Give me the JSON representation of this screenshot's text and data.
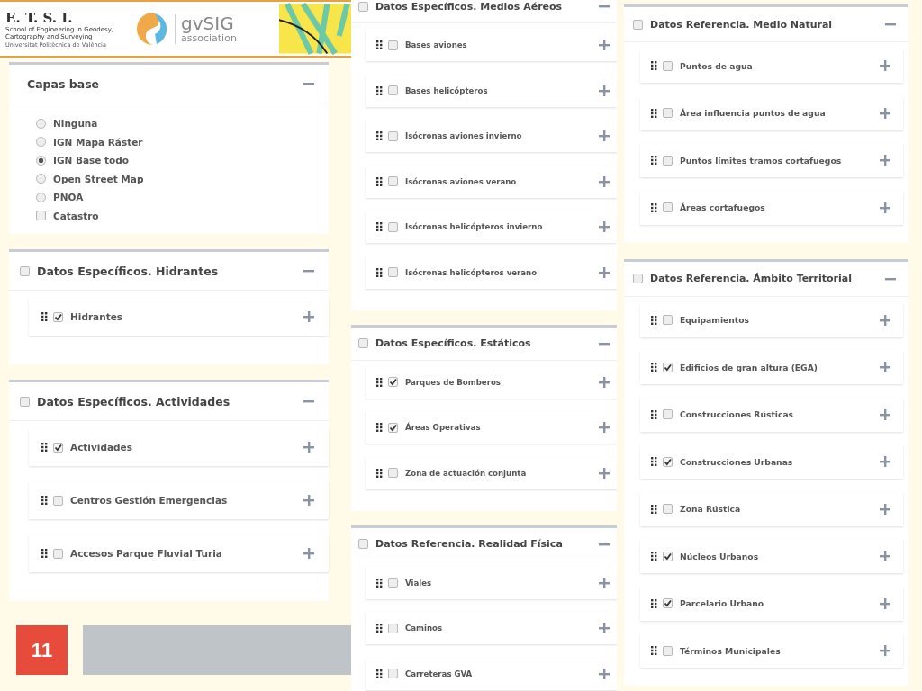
{
  "banner": {
    "etsi_title": "E. T. S. I.",
    "etsi_subtitle": "School of Engineering in Geodesy, Cartography and Surveying",
    "etsi_university": "Universitat Politècnica de València",
    "gvsig_name": "gvSIG",
    "gvsig_subtitle": "association"
  },
  "columns": [
    [
      {
        "kind": "base_layers",
        "title": "Capas base",
        "expanded": true,
        "options": [
          {
            "kind": "radio",
            "label": "Ninguna",
            "selected": false
          },
          {
            "kind": "radio",
            "label": "IGN Mapa Ráster",
            "selected": false
          },
          {
            "kind": "radio",
            "label": "IGN Base todo",
            "selected": true
          },
          {
            "kind": "radio",
            "label": "Open Street Map",
            "selected": false
          },
          {
            "kind": "radio",
            "label": "PNOA",
            "selected": false
          },
          {
            "kind": "checkbox",
            "label": "Catastro",
            "checked": false
          }
        ]
      },
      {
        "kind": "layer_group",
        "title": "Datos Específicos. Hidrantes",
        "checked": false,
        "expanded": true,
        "layers": [
          {
            "label": "Hidrantes",
            "checked": true
          }
        ]
      },
      {
        "kind": "layer_group",
        "title": "Datos Específicos. Actividades",
        "checked": false,
        "expanded": true,
        "layers": [
          {
            "label": "Actividades",
            "checked": true
          },
          {
            "label": "Centros Gestión Emergencias",
            "checked": false
          },
          {
            "label": "Accesos Parque Fluvial Turia",
            "checked": false
          }
        ]
      }
    ],
    [
      {
        "kind": "layer_group",
        "title": "Datos Específicos. Medios Aéreos",
        "checked": false,
        "expanded": true,
        "layers": [
          {
            "label": "Bases aviones",
            "checked": false
          },
          {
            "label": "Bases helicópteros",
            "checked": false
          },
          {
            "label": "Isócronas aviones invierno",
            "checked": false
          },
          {
            "label": "Isócronas aviones verano",
            "checked": false
          },
          {
            "label": "Isócronas helicópteros invierno",
            "checked": false
          },
          {
            "label": "Isócronas helicópteros verano",
            "checked": false
          }
        ]
      },
      {
        "kind": "layer_group",
        "title": "Datos Específicos. Estáticos",
        "checked": false,
        "expanded": true,
        "layers": [
          {
            "label": "Parques de Bomberos",
            "checked": true
          },
          {
            "label": "Áreas Operativas",
            "checked": true
          },
          {
            "label": "Zona de actuación conjunta",
            "checked": false
          }
        ]
      },
      {
        "kind": "layer_group",
        "title": "Datos Referencia. Realidad Física",
        "checked": false,
        "expanded": true,
        "layers": [
          {
            "label": "Viales",
            "checked": false
          },
          {
            "label": "Caminos",
            "checked": false
          },
          {
            "label": "Carreteras GVA",
            "checked": false
          }
        ]
      }
    ],
    [
      {
        "kind": "layer_group",
        "title": "Datos Referencia. Medio Natural",
        "checked": false,
        "expanded": true,
        "layers": [
          {
            "label": "Puntos de agua",
            "checked": false
          },
          {
            "label": "Área influencia puntos de agua",
            "checked": false
          },
          {
            "label": "Puntos límites tramos cortafuegos",
            "checked": false
          },
          {
            "label": "Áreas cortafuegos",
            "checked": false
          }
        ]
      },
      {
        "kind": "layer_group",
        "title": "Datos Referencia. Ámbito Territorial",
        "checked": false,
        "expanded": true,
        "layers": [
          {
            "label": "Equipamientos",
            "checked": false
          },
          {
            "label": "Edificios de gran altura (EGA)",
            "checked": true
          },
          {
            "label": "Construcciones Rústicas",
            "checked": false
          },
          {
            "label": "Construcciones Urbanas",
            "checked": true
          },
          {
            "label": "Zona Rústica",
            "checked": false
          },
          {
            "label": "Núcleos Urbanos",
            "checked": true
          },
          {
            "label": "Parcelario Urbano",
            "checked": true
          },
          {
            "label": "Términos Municipales",
            "checked": false
          }
        ]
      }
    ]
  ],
  "slide_number": "11"
}
